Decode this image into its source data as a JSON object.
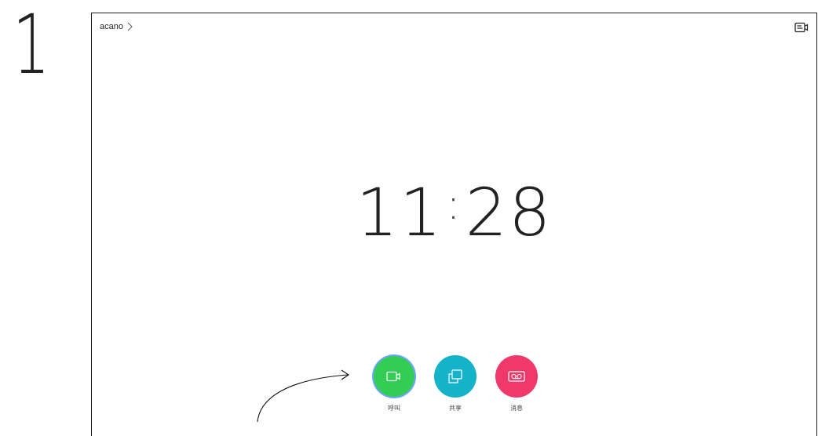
{
  "step_number": "1",
  "header": {
    "breadcrumb": "acano",
    "breadcrumb_icon": "chevron-right-icon",
    "camera_icon": "camera-self-view-icon"
  },
  "clock": {
    "hours": "11",
    "separator": ":",
    "minutes": "28"
  },
  "actions": [
    {
      "label": "呼叫",
      "icon": "video-call-icon",
      "color": "#33cc55"
    },
    {
      "label": "共享",
      "icon": "share-screen-icon",
      "color": "#14b3c9"
    },
    {
      "label": "消息",
      "icon": "voicemail-icon",
      "color": "#f0386a"
    }
  ]
}
